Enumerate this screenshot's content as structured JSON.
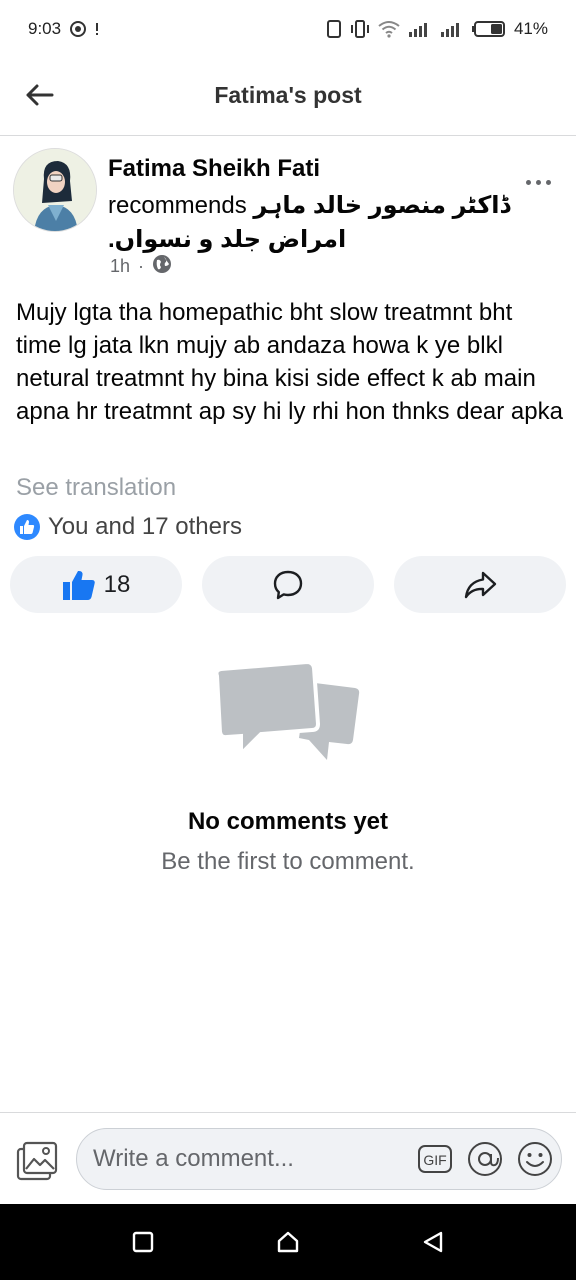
{
  "status_bar": {
    "time": "9:03",
    "battery": "41%"
  },
  "header": {
    "title": "Fatima's post"
  },
  "post": {
    "author": "Fatima Sheikh Fati",
    "recommends": "recommends",
    "page_name": "ڈاکٹر منصور خالد ماہر امراض جلد و نسواں.",
    "time": "1h",
    "dot": "·",
    "text": "Mujy lgta tha homepathic bht slow treatmnt bht time lg jata lkn mujy ab andaza howa k ye blkl netural treatmnt hy bina kisi side effect k ab main apna hr treatmnt ap sy hi ly rhi hon thnks dear apka",
    "see_translation": "See translation",
    "reactions_text": "You and 17 others",
    "like_count": "18"
  },
  "comments": {
    "empty_title": "No comments yet",
    "empty_subtitle": "Be the first to comment."
  },
  "composer": {
    "placeholder": "Write a comment...",
    "gif_label": "GIF"
  },
  "colors": {
    "accent": "#1877f2",
    "like_blue": "#2e89ff",
    "button_bg": "#f0f2f5",
    "secondary_text": "#65676b",
    "illustration": "#bcc0c4"
  }
}
